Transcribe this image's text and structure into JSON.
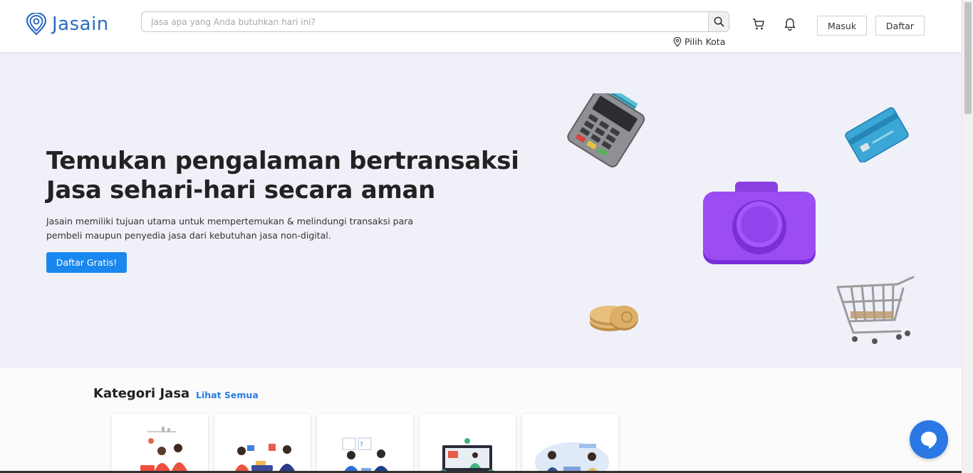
{
  "header": {
    "logo_text": "Jasain",
    "search_placeholder": "Jasa apa yang Anda butuhkan hari ini?",
    "city_label": "Pilih Kota",
    "login_label": "Masuk",
    "register_label": "Daftar",
    "icons": [
      "logo-pin-icon",
      "search-icon",
      "location-pin-icon",
      "cart-icon",
      "bell-icon"
    ]
  },
  "hero": {
    "title": "Temukan pengalaman bertransaksi Jasa sehari-hari secara aman",
    "description": "Jasain memiliki tujuan utama untuk mempertemukan & melindungi transaksi para pembeli maupun penyedia jasa dari kebutuhan jasa non-digital.",
    "cta_label": "Daftar Gratis!",
    "illustrations": [
      "card-terminal",
      "credit-card",
      "camera",
      "coins",
      "shopping-cart"
    ]
  },
  "categories": {
    "title": "Kategori Jasa",
    "see_all_label": "Lihat Semua",
    "cards": [
      "category-card-1",
      "category-card-2",
      "category-card-3",
      "category-card-4",
      "category-card-5"
    ]
  },
  "colors": {
    "brand": "#2d6bc4",
    "cta": "#1a87ef",
    "link": "#2a7de1",
    "hero_bg": "#f0f0f9",
    "chat": "#2b78e4"
  }
}
